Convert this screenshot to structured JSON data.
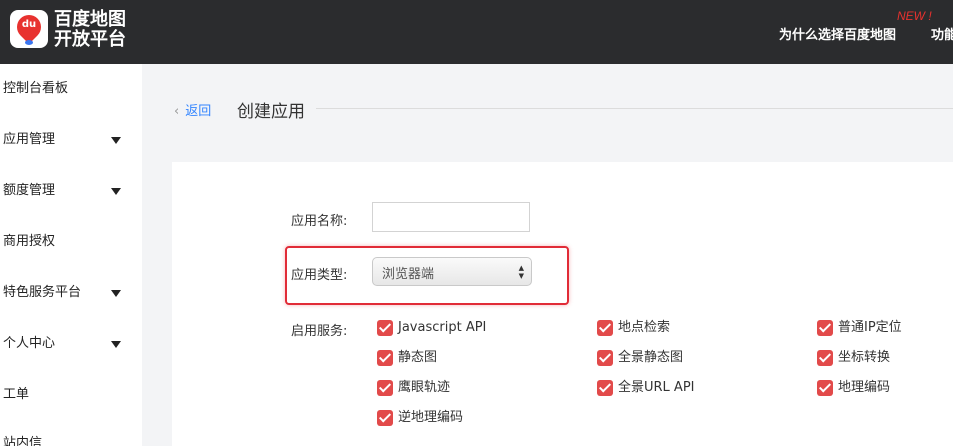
{
  "header": {
    "logo_line1": "百度地图",
    "logo_line2": "开放平台",
    "logo_badge": "du",
    "new_badge": "NEW !",
    "nav": [
      "为什么选择百度地图",
      "功能"
    ]
  },
  "sidebar": {
    "items": [
      {
        "label": "控制台看板",
        "has_submenu": false
      },
      {
        "label": "应用管理",
        "has_submenu": true
      },
      {
        "label": "额度管理",
        "has_submenu": true
      },
      {
        "label": "商用授权",
        "has_submenu": false
      },
      {
        "label": "特色服务平台",
        "has_submenu": true
      },
      {
        "label": "个人中心",
        "has_submenu": true
      },
      {
        "label": "工单",
        "has_submenu": false
      },
      {
        "label": "站内信",
        "has_submenu": false
      }
    ]
  },
  "page": {
    "back_label": "返回",
    "title": "创建应用"
  },
  "form": {
    "name_label": "应用名称:",
    "name_value": "",
    "type_label": "应用类型:",
    "type_value": "浏览器端",
    "services_label": "启用服务:",
    "services": [
      {
        "label": "Javascript API",
        "checked": true
      },
      {
        "label": "地点检索",
        "checked": true
      },
      {
        "label": "普通IP定位",
        "checked": true
      },
      {
        "label": "静态图",
        "checked": true
      },
      {
        "label": "全景静态图",
        "checked": true
      },
      {
        "label": "坐标转换",
        "checked": true
      },
      {
        "label": "鹰眼轨迹",
        "checked": true
      },
      {
        "label": "全景URL API",
        "checked": true
      },
      {
        "label": "地理编码",
        "checked": true
      },
      {
        "label": "逆地理编码",
        "checked": true
      }
    ]
  },
  "colors": {
    "topbar": "#2b2c2e",
    "accent_red": "#e12b37",
    "checkbox": "#e24a4a",
    "link": "#3385ff"
  }
}
